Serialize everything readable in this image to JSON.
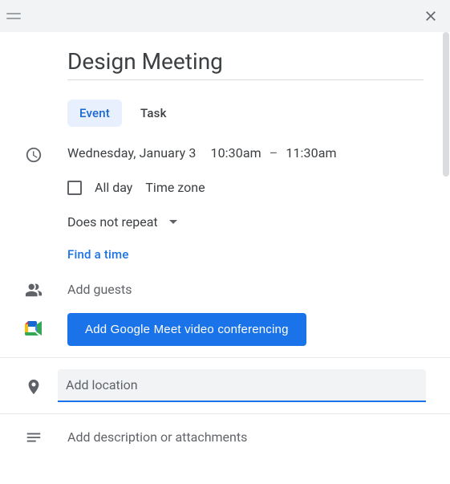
{
  "title": "Design Meeting",
  "tabs": {
    "event": "Event",
    "task": "Task"
  },
  "datetime": {
    "date": "Wednesday, January 3",
    "start": "10:30am",
    "end": "11:30am"
  },
  "allday_label": "All day",
  "timezone_label": "Time zone",
  "repeat_label": "Does not repeat",
  "find_time_label": "Find a time",
  "guests_placeholder": "Add guests",
  "meet_button_label": "Add Google Meet video conferencing",
  "location_placeholder": "Add location",
  "location_value": "",
  "description_placeholder": "Add description or attachments"
}
